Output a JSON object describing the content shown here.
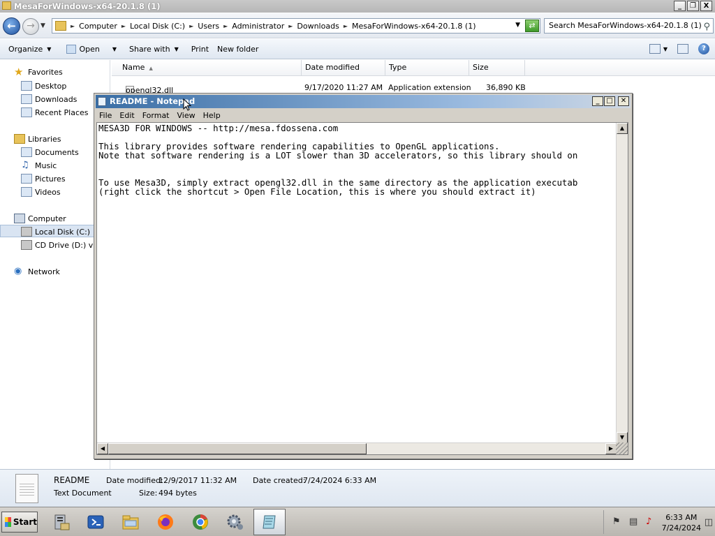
{
  "explorer": {
    "title": "MesaForWindows-x64-20.1.8 (1)",
    "window_buttons": [
      "_",
      "❐",
      "X"
    ],
    "breadcrumb": [
      "Computer",
      "Local Disk (C:)",
      "Users",
      "Administrator",
      "Downloads",
      "MesaForWindows-x64-20.1.8 (1)"
    ],
    "search_placeholder": "Search MesaForWindows-x64-20.1.8 (1)",
    "toolbar": {
      "organize": "Organize",
      "open": "Open",
      "share_with": "Share with",
      "print": "Print",
      "new_folder": "New folder"
    },
    "nav": {
      "favorites": "Favorites",
      "desktop": "Desktop",
      "downloads": "Downloads",
      "recent_places": "Recent Places",
      "libraries": "Libraries",
      "documents": "Documents",
      "music": "Music",
      "pictures": "Pictures",
      "videos": "Videos",
      "computer": "Computer",
      "local_disk": "Local Disk (C:)",
      "cd_drive": "CD Drive (D:) virt",
      "network": "Network"
    },
    "columns": {
      "name": "Name",
      "date_modified": "Date modified",
      "type": "Type",
      "size": "Size"
    },
    "files": [
      {
        "name": "opengl32.dll",
        "date": "9/17/2020 11:27 AM",
        "type": "Application extension",
        "size": "36,890 KB"
      }
    ],
    "details": {
      "name": "README",
      "kind": "Text Document",
      "date_modified_label": "Date modified:",
      "date_modified": "12/9/2017 11:32 AM",
      "date_created_label": "Date created:",
      "date_created": "7/24/2024 6:33 AM",
      "size_label": "Size:",
      "size": "494 bytes"
    }
  },
  "notepad": {
    "title": "README - Notepad",
    "menu": [
      "File",
      "Edit",
      "Format",
      "View",
      "Help"
    ],
    "lines": [
      "MESA3D FOR WINDOWS -- http://mesa.fdossena.com",
      "",
      "This library provides software rendering capabilities to OpenGL applications.",
      "Note that software rendering is a LOT slower than 3D accelerators, so this library should on",
      "",
      "",
      "To use Mesa3D, simply extract opengl32.dll in the same directory as the application executab",
      "(right click the shortcut > Open File Location, this is where you should extract it)"
    ]
  },
  "taskbar": {
    "start": "Start",
    "apps": [
      "server-manager-icon",
      "powershell-icon",
      "explorer-icon",
      "firefox-icon",
      "chrome-icon",
      "settings-icon",
      "notepad-icon"
    ],
    "clock_time": "6:33 AM",
    "clock_date": "7/24/2024"
  },
  "colors": {
    "notepad_title_start": "#3a6ea5",
    "explorer_title": "#c0c0c0",
    "selection": "#d9e4f2"
  }
}
